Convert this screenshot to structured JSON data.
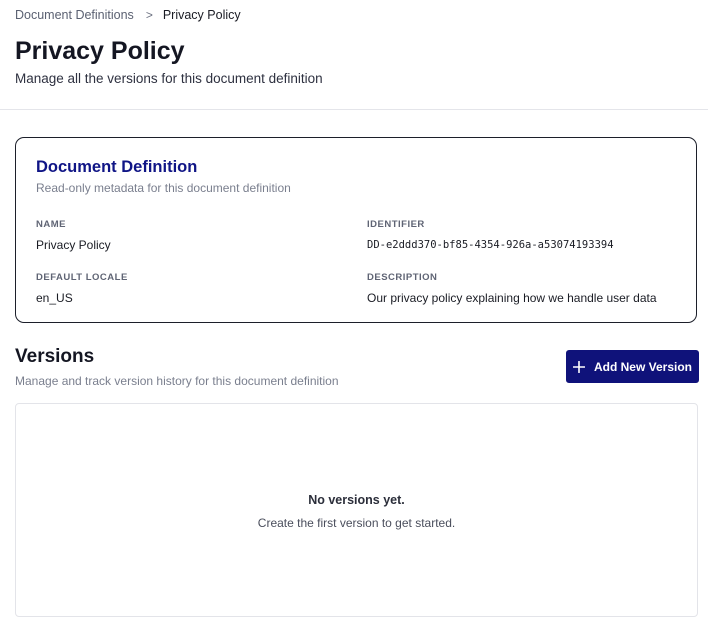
{
  "breadcrumb": {
    "parent": "Document Definitions",
    "separator": ">",
    "current": "Privacy Policy"
  },
  "page": {
    "title": "Privacy Policy",
    "subtitle": "Manage all the versions for this document definition"
  },
  "definition_card": {
    "title": "Document Definition",
    "subtitle": "Read-only metadata for this document definition",
    "fields": {
      "name": {
        "label": "NAME",
        "value": "Privacy Policy"
      },
      "identifier": {
        "label": "IDENTIFIER",
        "value": "DD-e2ddd370-bf85-4354-926a-a53074193394"
      },
      "default_locale": {
        "label": "DEFAULT LOCALE",
        "value": "en_US"
      },
      "description": {
        "label": "DESCRIPTION",
        "value": "Our privacy policy explaining how we handle user data"
      }
    }
  },
  "versions": {
    "title": "Versions",
    "subtitle": "Manage and track version history for this document definition",
    "add_button_label": "Add New Version",
    "add_button_icon": "plus-icon",
    "empty_title": "No versions yet.",
    "empty_text": "Create the first version to get started."
  },
  "colors": {
    "accent": "#0f127a",
    "card_title": "#101586",
    "muted_text": "#7a7f8e",
    "border_dark": "#1c1f2a",
    "border_light": "#e3e4e9"
  }
}
